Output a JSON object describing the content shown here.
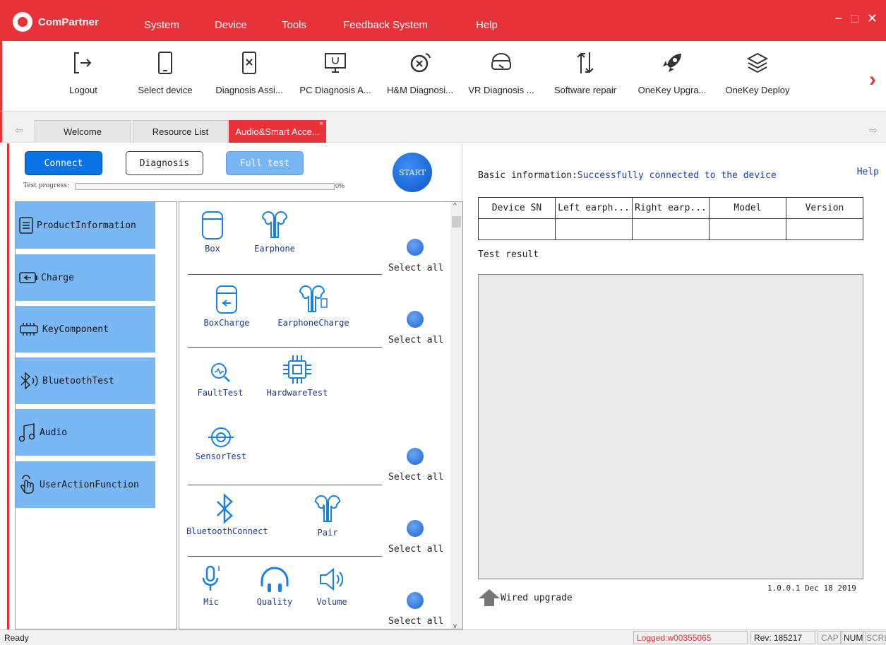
{
  "app": {
    "name": "ComPartner"
  },
  "menu": [
    "System",
    "Device",
    "Tools",
    "Feedback System",
    "Help"
  ],
  "window_controls": {
    "minimize": "−",
    "maximize": "□",
    "close": "✕"
  },
  "toolbar": [
    {
      "label": "Logout",
      "icon": "logout-icon"
    },
    {
      "label": "Select device",
      "icon": "phone-icon"
    },
    {
      "label": "Diagnosis Assi...",
      "icon": "diagnosis-phone-icon"
    },
    {
      "label": "PC Diagnosis A...",
      "icon": "pc-stethoscope-icon"
    },
    {
      "label": "H&M Diagnosi...",
      "icon": "watch-diagnosis-icon"
    },
    {
      "label": "VR Diagnosis ...",
      "icon": "vr-headset-icon"
    },
    {
      "label": "Software repair",
      "icon": "software-repair-icon"
    },
    {
      "label": "OneKey Upgra...",
      "icon": "rocket-icon"
    },
    {
      "label": "OneKey Deploy",
      "icon": "layers-icon"
    }
  ],
  "tabs": [
    {
      "label": "Welcome",
      "active": false
    },
    {
      "label": "Resource List",
      "active": false
    },
    {
      "label": "Audio&Smart Acce...",
      "active": true
    }
  ],
  "controls": {
    "connect": "Connect",
    "diagnosis": "Diagnosis",
    "full_test": "Full test",
    "start": "START",
    "progress_label": "Test progress:",
    "progress_value": "0%"
  },
  "categories": [
    {
      "label": "ProductInformation",
      "icon": "document-icon"
    },
    {
      "label": "Charge",
      "icon": "battery-charge-icon"
    },
    {
      "label": "KeyComponent",
      "icon": "chip-icon"
    },
    {
      "label": "BluetoothTest",
      "icon": "bluetooth-icon"
    },
    {
      "label": "Audio",
      "icon": "music-note-icon"
    },
    {
      "label": "UserActionFunction",
      "icon": "hand-tap-icon"
    }
  ],
  "items": {
    "box": "Box",
    "earphone": "Earphone",
    "box_charge": "BoxCharge",
    "earphone_charge": "EarphoneCharge",
    "fault_test": "FaultTest",
    "hardware_test": "HardwareTest",
    "sensor_test": "SensorTest",
    "bluetooth_connect": "BluetoothConnect",
    "pair": "Pair",
    "mic": "Mic",
    "quality": "Quality",
    "volume": "Volume",
    "select_all": "Select all"
  },
  "right": {
    "help": "Help",
    "basic_info_label": "Basic information:",
    "basic_info_value": "Successfully connected to the device",
    "table_headers": [
      "Device SN",
      "Left earph...",
      "Right earp...",
      "Model",
      "Version"
    ],
    "test_result": "Test result",
    "version": "1.0.0.1 Dec 18 2019",
    "wired_upgrade": "Wired upgrade"
  },
  "status": {
    "ready": "Ready",
    "logged": "Logged:w00355065",
    "rev": "Rev: 185217",
    "cap": "CAP",
    "num": "NUM",
    "scrl": "SCRL"
  },
  "colors": {
    "brand": "#e8323a",
    "primary": "#0a73e6",
    "category": "#7ab8f5",
    "link": "#1840b0"
  }
}
